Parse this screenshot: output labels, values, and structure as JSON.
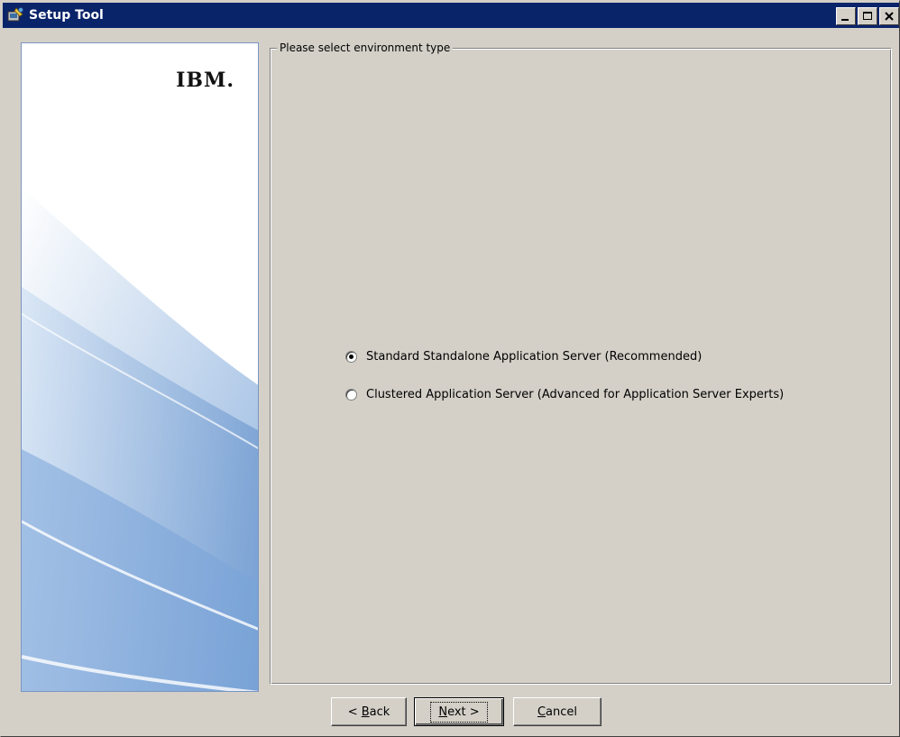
{
  "window": {
    "title": "Setup Tool",
    "controls": {
      "minimize": "minimize",
      "maximize": "maximize",
      "close": "close"
    }
  },
  "sidebar": {
    "logo_text": "IBM."
  },
  "group": {
    "legend": "Please select environment type",
    "options": [
      {
        "label": "Standard Standalone Application Server (Recommended)",
        "selected": true
      },
      {
        "label": "Clustered Application Server (Advanced for Application Server Experts)",
        "selected": false
      }
    ]
  },
  "buttons": {
    "back": {
      "prefix": "< ",
      "mnemonic": "B",
      "rest": "ack"
    },
    "next": {
      "mnemonic": "N",
      "rest": "ext >"
    },
    "cancel": {
      "mnemonic": "C",
      "rest": "ancel"
    }
  },
  "colors": {
    "titlebar": "#0a246a",
    "face": "#d4d0c8",
    "panel_border": "#7a96c0"
  }
}
